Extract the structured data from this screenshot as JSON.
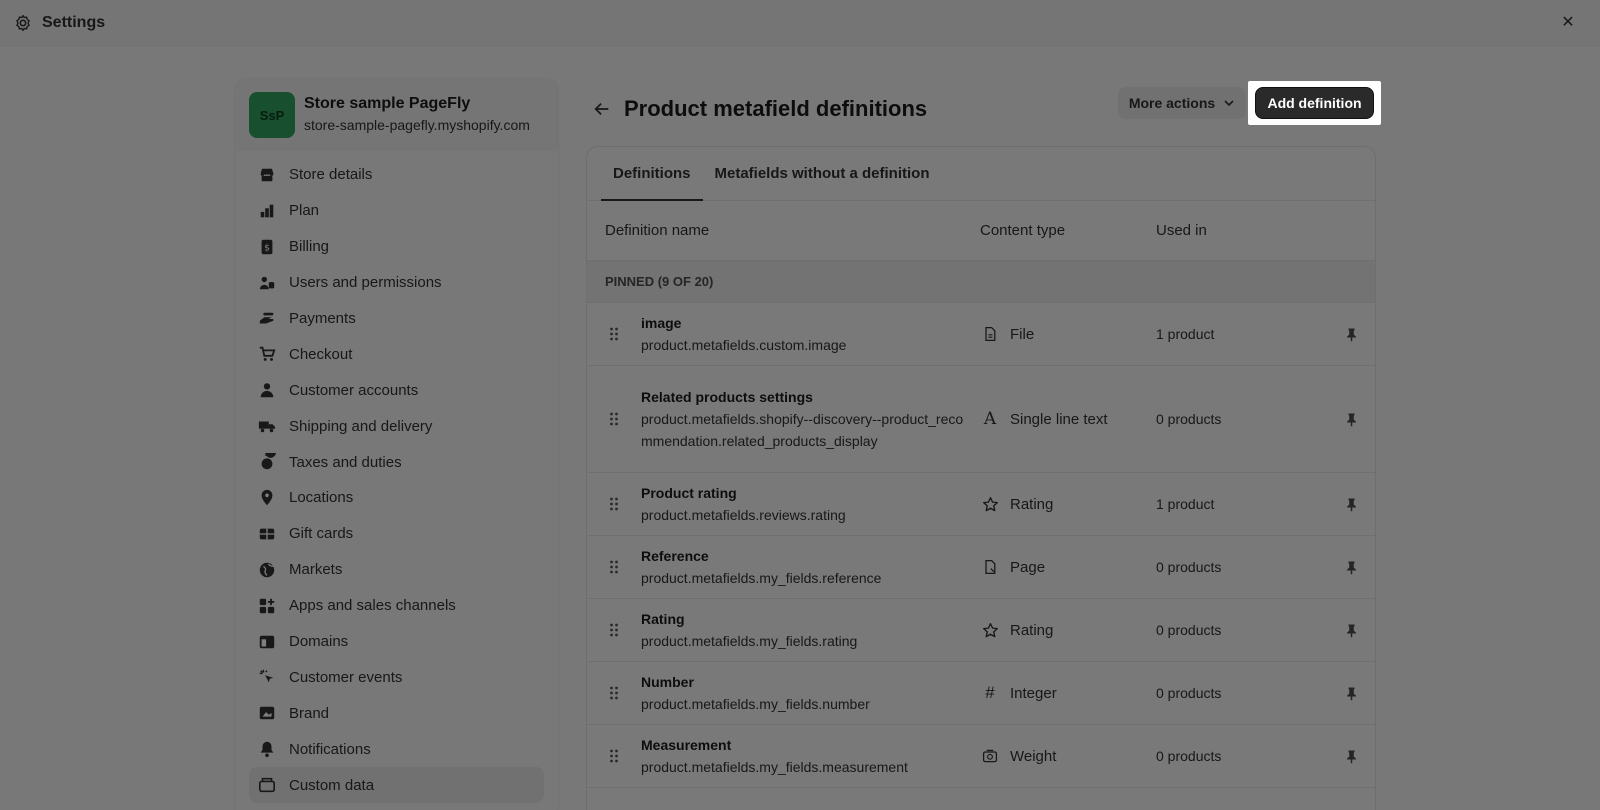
{
  "topbar": {
    "title": "Settings",
    "icon": "gear-icon",
    "close_icon": "close-icon"
  },
  "store": {
    "initials": "SsP",
    "name": "Store sample PageFly",
    "url": "store-sample-pagefly.myshopify.com",
    "avatar_color": "#2e9f5e"
  },
  "sidebar": {
    "items": [
      {
        "label": "Store details",
        "icon": "store-icon"
      },
      {
        "label": "Plan",
        "icon": "plan-icon"
      },
      {
        "label": "Billing",
        "icon": "billing-icon"
      },
      {
        "label": "Users and permissions",
        "icon": "users-icon"
      },
      {
        "label": "Payments",
        "icon": "payments-icon"
      },
      {
        "label": "Checkout",
        "icon": "cart-icon"
      },
      {
        "label": "Customer accounts",
        "icon": "person-icon"
      },
      {
        "label": "Shipping and delivery",
        "icon": "truck-icon"
      },
      {
        "label": "Taxes and duties",
        "icon": "taxes-icon"
      },
      {
        "label": "Locations",
        "icon": "location-icon"
      },
      {
        "label": "Gift cards",
        "icon": "gift-card-icon"
      },
      {
        "label": "Markets",
        "icon": "globe-icon"
      },
      {
        "label": "Apps and sales channels",
        "icon": "apps-icon"
      },
      {
        "label": "Domains",
        "icon": "domains-icon"
      },
      {
        "label": "Customer events",
        "icon": "cursor-icon"
      },
      {
        "label": "Brand",
        "icon": "brand-icon"
      },
      {
        "label": "Notifications",
        "icon": "bell-icon"
      },
      {
        "label": "Custom data",
        "icon": "custom-data-icon",
        "active": true
      }
    ]
  },
  "header": {
    "title": "Product metafield definitions",
    "more_actions": "More actions",
    "add_definition": "Add definition"
  },
  "tabs": [
    {
      "label": "Definitions",
      "active": true
    },
    {
      "label": "Metafields without a definition"
    }
  ],
  "table": {
    "columns": {
      "name": "Definition name",
      "type": "Content type",
      "used": "Used in"
    },
    "section": "PINNED (9 OF 20)",
    "rows": [
      {
        "name": "image",
        "key": "product.metafields.custom.image",
        "type": "File",
        "type_icon": "file-icon",
        "used": "1 product"
      },
      {
        "name": "Related products settings",
        "key": "product.metafields.shopify--discovery--product_recommendation.related_products_display",
        "type": "Single line text",
        "type_icon": "text-icon",
        "used": "0 products"
      },
      {
        "name": "Product rating",
        "key": "product.metafields.reviews.rating",
        "type": "Rating",
        "type_icon": "star-icon",
        "used": "1 product"
      },
      {
        "name": "Reference",
        "key": "product.metafields.my_fields.reference",
        "type": "Page",
        "type_icon": "page-icon",
        "used": "0 products"
      },
      {
        "name": "Rating",
        "key": "product.metafields.my_fields.rating",
        "type": "Rating",
        "type_icon": "star-icon",
        "used": "0 products"
      },
      {
        "name": "Number",
        "key": "product.metafields.my_fields.number",
        "type": "Integer",
        "type_icon": "hash-icon",
        "used": "0 products"
      },
      {
        "name": "Measurement",
        "key": "product.metafields.my_fields.measurement",
        "type": "Weight",
        "type_icon": "weight-icon",
        "used": "0 products"
      }
    ]
  }
}
